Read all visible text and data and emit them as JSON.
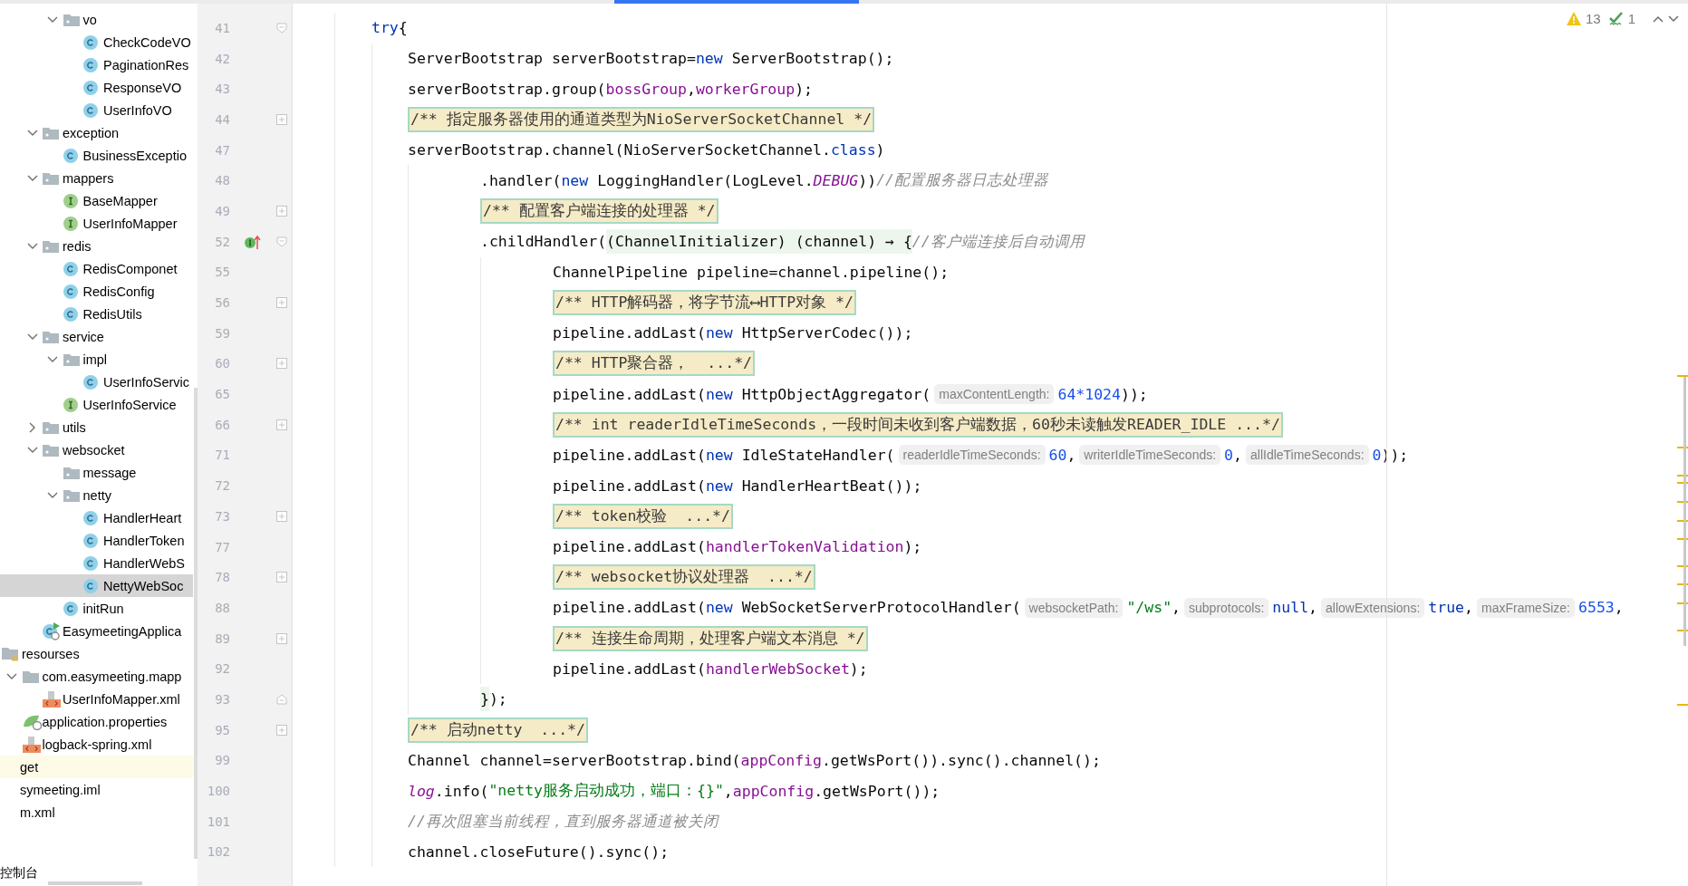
{
  "project_tree": [
    {
      "children": [
        {
          "children": [
            {
              "children": [
                {
                  "children": [
                    {
                      "label": "vo",
                      "kind": "folder",
                      "expanded": true,
                      "selected": false,
                      "highlighted": false,
                      "children": [
                        {
                          "label": "CheckCodeVO",
                          "kind": "class",
                          "selected": false,
                          "highlighted": false
                        },
                        {
                          "label": "PaginationRes",
                          "kind": "class",
                          "selected": false,
                          "highlighted": false
                        },
                        {
                          "label": "ResponseVO",
                          "kind": "class",
                          "selected": false,
                          "highlighted": false
                        },
                        {
                          "label": "UserInfoVO",
                          "kind": "class",
                          "selected": false,
                          "highlighted": false
                        }
                      ]
                    }
                  ]
                },
                {
                  "label": "exception",
                  "kind": "folder",
                  "expanded": true,
                  "selected": false,
                  "highlighted": false,
                  "children": [
                    {
                      "label": "BusinessExceptio",
                      "kind": "class",
                      "selected": false,
                      "highlighted": false
                    }
                  ]
                },
                {
                  "label": "mappers",
                  "kind": "folder",
                  "expanded": true,
                  "selected": false,
                  "highlighted": false,
                  "children": [
                    {
                      "label": "BaseMapper",
                      "kind": "interface",
                      "selected": false,
                      "highlighted": false
                    },
                    {
                      "label": "UserInfoMapper",
                      "kind": "interface",
                      "selected": false,
                      "highlighted": false
                    }
                  ]
                },
                {
                  "label": "redis",
                  "kind": "folder",
                  "expanded": true,
                  "selected": false,
                  "highlighted": false,
                  "children": [
                    {
                      "label": "RedisComponet",
                      "kind": "class",
                      "selected": false,
                      "highlighted": false
                    },
                    {
                      "label": "RedisConfig",
                      "kind": "class",
                      "selected": false,
                      "highlighted": false
                    },
                    {
                      "label": "RedisUtils",
                      "kind": "class",
                      "selected": false,
                      "highlighted": false
                    }
                  ]
                },
                {
                  "label": "service",
                  "kind": "folder",
                  "expanded": true,
                  "selected": false,
                  "highlighted": false,
                  "children": [
                    {
                      "label": "impl",
                      "kind": "folder",
                      "expanded": true,
                      "selected": false,
                      "highlighted": false,
                      "children": [
                        {
                          "label": "UserInfoServic",
                          "kind": "class",
                          "selected": false,
                          "highlighted": false
                        }
                      ]
                    },
                    {
                      "label": "UserInfoService",
                      "kind": "interface",
                      "selected": false,
                      "highlighted": false
                    }
                  ]
                },
                {
                  "label": "utils",
                  "kind": "folder",
                  "expanded": false,
                  "selected": false,
                  "highlighted": false
                },
                {
                  "label": "websocket",
                  "kind": "folder",
                  "expanded": true,
                  "selected": false,
                  "highlighted": false,
                  "children": [
                    {
                      "label": "message",
                      "kind": "folder",
                      "selected": false,
                      "highlighted": false
                    },
                    {
                      "label": "netty",
                      "kind": "folder",
                      "expanded": true,
                      "selected": false,
                      "highlighted": false,
                      "children": [
                        {
                          "label": "HandlerHeart",
                          "kind": "class",
                          "selected": false,
                          "highlighted": false
                        },
                        {
                          "label": "HandlerToken",
                          "kind": "class",
                          "selected": false,
                          "highlighted": false
                        },
                        {
                          "label": "HandlerWebS",
                          "kind": "class",
                          "selected": false,
                          "highlighted": false
                        },
                        {
                          "label": "NettyWebSoc",
                          "kind": "class",
                          "selected": true,
                          "highlighted": false
                        }
                      ]
                    },
                    {
                      "label": "initRun",
                      "kind": "class",
                      "selected": false,
                      "highlighted": false
                    }
                  ]
                },
                {
                  "label": "EasymeetingApplica",
                  "kind": "app",
                  "selected": false,
                  "highlighted": false
                }
              ]
            }
          ]
        },
        {
          "label": "resourses",
          "kind": "resources",
          "selected": false,
          "highlighted": false,
          "children": [
            {
              "label": "com.easymeeting.mapp",
              "kind": "package",
              "expanded": true,
              "selected": false,
              "highlighted": false,
              "children": [
                {
                  "label": "UserInfoMapper.xml",
                  "kind": "xml",
                  "selected": false,
                  "highlighted": false
                }
              ]
            },
            {
              "label": "application.properties",
              "kind": "properties",
              "selected": false,
              "highlighted": false
            },
            {
              "label": "logback-spring.xml",
              "kind": "xml",
              "selected": false,
              "highlighted": false
            }
          ]
        }
      ]
    },
    {
      "label": "get",
      "selected": false,
      "highlighted": true
    },
    {
      "label": "symeeting.iml",
      "selected": false,
      "highlighted": false
    },
    {
      "label": "m.xml",
      "selected": false,
      "highlighted": false
    }
  ],
  "bottom_tab": "控制台",
  "inspections": {
    "warnings": "13",
    "typos": "1"
  },
  "code": [
    {
      "number": "41",
      "expanded": true,
      "tokens": [
        {
          "kind": "keyword",
          "text": "try"
        },
        {
          "kind": "plain",
          "text": "{"
        }
      ],
      "children": [
        {
          "number": "42",
          "tokens": [
            {
              "kind": "plain",
              "text": "ServerBootstrap serverBootstrap="
            },
            {
              "kind": "keyword",
              "text": "new"
            },
            {
              "kind": "plain",
              "text": " ServerBootstrap();"
            }
          ]
        },
        {
          "number": "43",
          "tokens": [
            {
              "kind": "plain",
              "text": "serverBootstrap.group("
            },
            {
              "kind": "field",
              "text": "bossGroup"
            },
            {
              "kind": "plain",
              "text": ","
            },
            {
              "kind": "field",
              "text": "workerGroup"
            },
            {
              "kind": "plain",
              "text": ");"
            }
          ]
        },
        {
          "number": "44",
          "expanded": false,
          "tokens": [
            {
              "kind": "folded",
              "text": "/** 指定服务器使用的通道类型为NioServerSocketChannel */"
            }
          ]
        },
        {
          "number": "47",
          "tokens": [
            {
              "kind": "plain",
              "text": "serverBootstrap.channel(NioServerSocketChannel."
            },
            {
              "kind": "keyword",
              "text": "class"
            },
            {
              "kind": "plain",
              "text": ")"
            }
          ],
          "children": [
            {
              "number": "48",
              "tokens": [
                {
                  "kind": "plain",
                  "text": ".handler("
                },
                {
                  "kind": "keyword",
                  "text": "new"
                },
                {
                  "kind": "plain",
                  "text": " LoggingHandler(LogLevel."
                },
                {
                  "kind": "static",
                  "text": "DEBUG"
                },
                {
                  "kind": "plain",
                  "text": "))"
                },
                {
                  "kind": "comment",
                  "text": "//配置服务器日志处理器"
                }
              ]
            },
            {
              "number": "49",
              "expanded": false,
              "tokens": [
                {
                  "kind": "folded",
                  "text": "/** 配置客户端连接的处理器 */"
                }
              ]
            },
            {
              "number": "52",
              "expanded": true,
              "kind": "implements",
              "tokens": [
                {
                  "kind": "plain",
                  "text": ".childHandler("
                },
                {
                  "kind": "lambda",
                  "text": "(ChannelInitializer) (channel) → {"
                },
                {
                  "kind": "comment",
                  "text": "//客户端连接后自动调用"
                }
              ],
              "children": [
                {
                  "number": "55",
                  "tokens": [
                    {
                      "kind": "plain",
                      "text": "ChannelPipeline pipeline=channel.pipeline();"
                    }
                  ]
                },
                {
                  "number": "56",
                  "expanded": false,
                  "tokens": [
                    {
                      "kind": "folded",
                      "text": "/** HTTP解码器，将字节流⟷HTTP对象 */"
                    }
                  ]
                },
                {
                  "number": "59",
                  "tokens": [
                    {
                      "kind": "plain",
                      "text": "pipeline.addLast("
                    },
                    {
                      "kind": "keyword",
                      "text": "new"
                    },
                    {
                      "kind": "plain",
                      "text": " HttpServerCodec());"
                    }
                  ]
                },
                {
                  "number": "60",
                  "expanded": false,
                  "tokens": [
                    {
                      "kind": "folded",
                      "text": "/** HTTP聚合器，  ...*/"
                    }
                  ]
                },
                {
                  "number": "65",
                  "tokens": [
                    {
                      "kind": "plain",
                      "text": "pipeline.addLast("
                    },
                    {
                      "kind": "keyword",
                      "text": "new"
                    },
                    {
                      "kind": "plain",
                      "text": " HttpObjectAggregator("
                    },
                    {
                      "kind": "hint",
                      "text": "maxContentLength:"
                    },
                    {
                      "kind": "number",
                      "text": "64*1024"
                    },
                    {
                      "kind": "plain",
                      "text": "));"
                    }
                  ]
                },
                {
                  "number": "66",
                  "expanded": false,
                  "tokens": [
                    {
                      "kind": "folded",
                      "text": "/** int readerIdleTimeSeconds，一段时间未收到客户端数据，60秒未读触发READER_IDLE ...*/"
                    }
                  ]
                },
                {
                  "number": "71",
                  "tokens": [
                    {
                      "kind": "plain",
                      "text": "pipeline.addLast("
                    },
                    {
                      "kind": "keyword",
                      "text": "new"
                    },
                    {
                      "kind": "plain",
                      "text": " IdleStateHandler("
                    },
                    {
                      "kind": "hint",
                      "text": "readerIdleTimeSeconds:"
                    },
                    {
                      "kind": "number",
                      "text": "60"
                    },
                    {
                      "kind": "plain",
                      "text": ","
                    },
                    {
                      "kind": "hint",
                      "text": "writerIdleTimeSeconds:"
                    },
                    {
                      "kind": "number",
                      "text": "0"
                    },
                    {
                      "kind": "plain",
                      "text": ","
                    },
                    {
                      "kind": "hint",
                      "text": "allIdleTimeSeconds:"
                    },
                    {
                      "kind": "number",
                      "text": "0"
                    },
                    {
                      "kind": "plain",
                      "text": "));"
                    }
                  ]
                },
                {
                  "number": "72",
                  "tokens": [
                    {
                      "kind": "plain",
                      "text": "pipeline.addLast("
                    },
                    {
                      "kind": "keyword",
                      "text": "new"
                    },
                    {
                      "kind": "plain",
                      "text": " HandlerHeartBeat());"
                    }
                  ]
                },
                {
                  "number": "73",
                  "expanded": false,
                  "tokens": [
                    {
                      "kind": "folded",
                      "text": "/** token校验  ...*/"
                    }
                  ]
                },
                {
                  "number": "77",
                  "tokens": [
                    {
                      "kind": "plain",
                      "text": "pipeline.addLast("
                    },
                    {
                      "kind": "field",
                      "text": "handlerTokenValidation"
                    },
                    {
                      "kind": "plain",
                      "text": ");"
                    }
                  ]
                },
                {
                  "number": "78",
                  "expanded": false,
                  "tokens": [
                    {
                      "kind": "folded",
                      "text": "/** websocket协议处理器  ...*/"
                    }
                  ]
                },
                {
                  "number": "88",
                  "tokens": [
                    {
                      "kind": "plain",
                      "text": "pipeline.addLast("
                    },
                    {
                      "kind": "keyword",
                      "text": "new"
                    },
                    {
                      "kind": "plain",
                      "text": " WebSocketServerProtocolHandler("
                    },
                    {
                      "kind": "hint",
                      "text": "websocketPath:"
                    },
                    {
                      "kind": "string",
                      "text": "\"/ws\""
                    },
                    {
                      "kind": "plain",
                      "text": ","
                    },
                    {
                      "kind": "hint",
                      "text": "subprotocols:"
                    },
                    {
                      "kind": "keyword",
                      "text": "null"
                    },
                    {
                      "kind": "plain",
                      "text": ","
                    },
                    {
                      "kind": "hint",
                      "text": "allowExtensions:"
                    },
                    {
                      "kind": "keyword",
                      "text": "true"
                    },
                    {
                      "kind": "plain",
                      "text": ","
                    },
                    {
                      "kind": "hint",
                      "text": "maxFrameSize:"
                    },
                    {
                      "kind": "number",
                      "text": "6553"
                    },
                    {
                      "kind": "plain",
                      "text": ","
                    }
                  ]
                },
                {
                  "number": "89",
                  "expanded": false,
                  "tokens": [
                    {
                      "kind": "folded",
                      "text": "/** 连接生命周期，处理客户端文本消息 */"
                    }
                  ]
                },
                {
                  "number": "92",
                  "tokens": [
                    {
                      "kind": "plain",
                      "text": "pipeline.addLast("
                    },
                    {
                      "kind": "field",
                      "text": "handlerWebSocket"
                    },
                    {
                      "kind": "plain",
                      "text": ");"
                    }
                  ]
                }
              ]
            },
            {
              "number": "93",
              "expanded": true,
              "tokens": [
                {
                  "kind": "lambda",
                  "text": "}"
                },
                {
                  "kind": "plain",
                  "text": ");"
                }
              ]
            }
          ]
        },
        {
          "number": "95",
          "expanded": false,
          "tokens": [
            {
              "kind": "folded",
              "text": "/** 启动netty  ...*/"
            }
          ]
        },
        {
          "number": "99",
          "tokens": [
            {
              "kind": "plain",
              "text": "Channel channel=serverBootstrap.bind("
            },
            {
              "kind": "field",
              "text": "appConfig"
            },
            {
              "kind": "plain",
              "text": ".getWsPort()).sync().channel();"
            }
          ]
        },
        {
          "number": "100",
          "tokens": [
            {
              "kind": "static",
              "text": "log"
            },
            {
              "kind": "plain",
              "text": ".info("
            },
            {
              "kind": "string",
              "text": "\"netty服务启动成功，端口：{}\""
            },
            {
              "kind": "plain",
              "text": ","
            },
            {
              "kind": "field",
              "text": "appConfig"
            },
            {
              "kind": "plain",
              "text": ".getWsPort());"
            }
          ]
        },
        {
          "number": "101",
          "tokens": [
            {
              "kind": "comment",
              "text": "//再次阻塞当前线程，直到服务器通道被关闭"
            }
          ]
        },
        {
          "number": "102",
          "tokens": [
            {
              "kind": "plain",
              "text": "channel.closeFuture().sync();"
            }
          ]
        }
      ]
    }
  ]
}
